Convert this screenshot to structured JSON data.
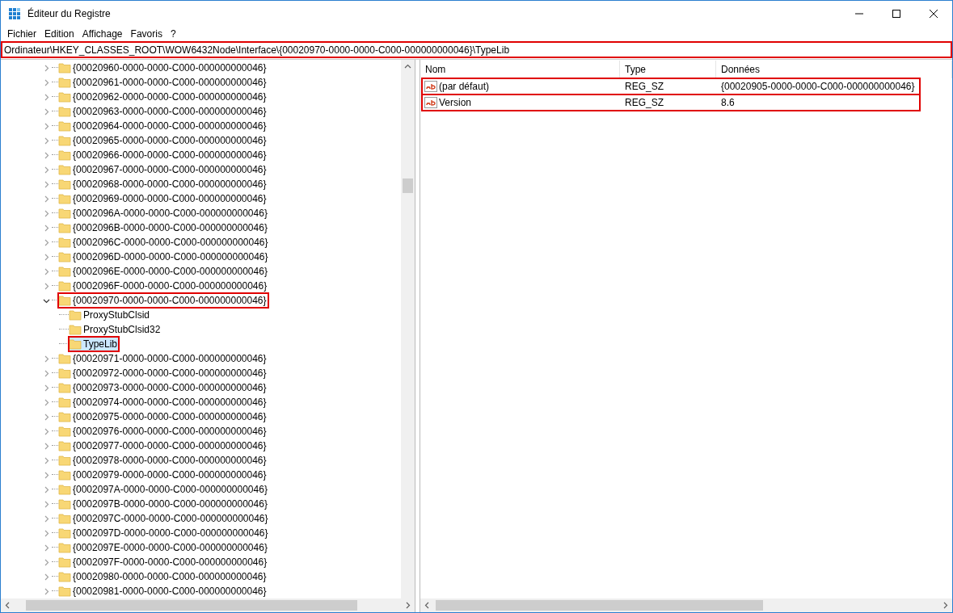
{
  "window": {
    "title": "Éditeur du Registre"
  },
  "menu": [
    "Fichier",
    "Edition",
    "Affichage",
    "Favoris",
    "?"
  ],
  "address_bar": {
    "value": "Ordinateur\\HKEY_CLASSES_ROOT\\WOW6432Node\\Interface\\{00020970-0000-0000-C000-000000000046}\\TypeLib",
    "highlighted": true
  },
  "tree": [
    {
      "label": "{00020960-0000-0000-C000-000000000046}",
      "expanded": false,
      "selected": false,
      "highlighted": false
    },
    {
      "label": "{00020961-0000-0000-C000-000000000046}",
      "expanded": false,
      "selected": false,
      "highlighted": false
    },
    {
      "label": "{00020962-0000-0000-C000-000000000046}",
      "expanded": false,
      "selected": false,
      "highlighted": false
    },
    {
      "label": "{00020963-0000-0000-C000-000000000046}",
      "expanded": false,
      "selected": false,
      "highlighted": false
    },
    {
      "label": "{00020964-0000-0000-C000-000000000046}",
      "expanded": false,
      "selected": false,
      "highlighted": false
    },
    {
      "label": "{00020965-0000-0000-C000-000000000046}",
      "expanded": false,
      "selected": false,
      "highlighted": false
    },
    {
      "label": "{00020966-0000-0000-C000-000000000046}",
      "expanded": false,
      "selected": false,
      "highlighted": false
    },
    {
      "label": "{00020967-0000-0000-C000-000000000046}",
      "expanded": false,
      "selected": false,
      "highlighted": false
    },
    {
      "label": "{00020968-0000-0000-C000-000000000046}",
      "expanded": false,
      "selected": false,
      "highlighted": false
    },
    {
      "label": "{00020969-0000-0000-C000-000000000046}",
      "expanded": false,
      "selected": false,
      "highlighted": false
    },
    {
      "label": "{0002096A-0000-0000-C000-000000000046}",
      "expanded": false,
      "selected": false,
      "highlighted": false
    },
    {
      "label": "{0002096B-0000-0000-C000-000000000046}",
      "expanded": false,
      "selected": false,
      "highlighted": false
    },
    {
      "label": "{0002096C-0000-0000-C000-000000000046}",
      "expanded": false,
      "selected": false,
      "highlighted": false
    },
    {
      "label": "{0002096D-0000-0000-C000-000000000046}",
      "expanded": false,
      "selected": false,
      "highlighted": false
    },
    {
      "label": "{0002096E-0000-0000-C000-000000000046}",
      "expanded": false,
      "selected": false,
      "highlighted": false
    },
    {
      "label": "{0002096F-0000-0000-C000-000000000046}",
      "expanded": false,
      "selected": false,
      "highlighted": false
    },
    {
      "label": "{00020970-0000-0000-C000-000000000046}",
      "expanded": true,
      "selected": false,
      "highlighted": true,
      "children": [
        {
          "label": "ProxyStubClsid",
          "selected": false,
          "highlighted": false
        },
        {
          "label": "ProxyStubClsid32",
          "selected": false,
          "highlighted": false
        },
        {
          "label": "TypeLib",
          "selected": true,
          "highlighted": true
        }
      ]
    },
    {
      "label": "{00020971-0000-0000-C000-000000000046}",
      "expanded": false,
      "selected": false,
      "highlighted": false
    },
    {
      "label": "{00020972-0000-0000-C000-000000000046}",
      "expanded": false,
      "selected": false,
      "highlighted": false
    },
    {
      "label": "{00020973-0000-0000-C000-000000000046}",
      "expanded": false,
      "selected": false,
      "highlighted": false
    },
    {
      "label": "{00020974-0000-0000-C000-000000000046}",
      "expanded": false,
      "selected": false,
      "highlighted": false
    },
    {
      "label": "{00020975-0000-0000-C000-000000000046}",
      "expanded": false,
      "selected": false,
      "highlighted": false
    },
    {
      "label": "{00020976-0000-0000-C000-000000000046}",
      "expanded": false,
      "selected": false,
      "highlighted": false
    },
    {
      "label": "{00020977-0000-0000-C000-000000000046}",
      "expanded": false,
      "selected": false,
      "highlighted": false
    },
    {
      "label": "{00020978-0000-0000-C000-000000000046}",
      "expanded": false,
      "selected": false,
      "highlighted": false
    },
    {
      "label": "{00020979-0000-0000-C000-000000000046}",
      "expanded": false,
      "selected": false,
      "highlighted": false
    },
    {
      "label": "{0002097A-0000-0000-C000-000000000046}",
      "expanded": false,
      "selected": false,
      "highlighted": false
    },
    {
      "label": "{0002097B-0000-0000-C000-000000000046}",
      "expanded": false,
      "selected": false,
      "highlighted": false
    },
    {
      "label": "{0002097C-0000-0000-C000-000000000046}",
      "expanded": false,
      "selected": false,
      "highlighted": false
    },
    {
      "label": "{0002097D-0000-0000-C000-000000000046}",
      "expanded": false,
      "selected": false,
      "highlighted": false
    },
    {
      "label": "{0002097E-0000-0000-C000-000000000046}",
      "expanded": false,
      "selected": false,
      "highlighted": false
    },
    {
      "label": "{0002097F-0000-0000-C000-000000000046}",
      "expanded": false,
      "selected": false,
      "highlighted": false
    },
    {
      "label": "{00020980-0000-0000-C000-000000000046}",
      "expanded": false,
      "selected": false,
      "highlighted": false
    },
    {
      "label": "{00020981-0000-0000-C000-000000000046}",
      "expanded": false,
      "selected": false,
      "highlighted": false
    }
  ],
  "values": {
    "columns": [
      "Nom",
      "Type",
      "Données"
    ],
    "rows": [
      {
        "name": "(par défaut)",
        "type": "REG_SZ",
        "data": "{00020905-0000-0000-C000-000000000046}",
        "highlighted": true
      },
      {
        "name": "Version",
        "type": "REG_SZ",
        "data": "8.6",
        "highlighted": true
      }
    ]
  }
}
